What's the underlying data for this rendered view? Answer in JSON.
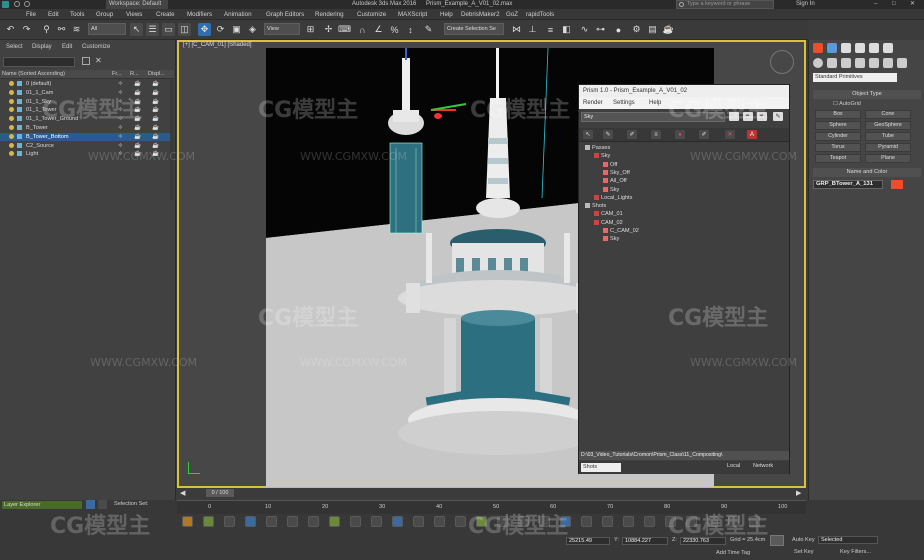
{
  "title_bar": {
    "workspace": "Workspace: Default",
    "app_title": "Autodesk 3ds Max 2016",
    "file": "Prism_Example_A_V01_02.max",
    "search_placeholder": "Type a keyword or phrase",
    "sign_in": "Sign In"
  },
  "menu": [
    "File",
    "Edit",
    "Tools",
    "Group",
    "Views",
    "Create",
    "Modifiers",
    "Animation",
    "Graph Editors",
    "Rendering",
    "Customize",
    "MAXScript",
    "Help",
    "DebrisMaker2",
    "GoZ",
    "rapidTools"
  ],
  "toolbar": {
    "filter_value": "All",
    "refcoord_value": "View",
    "selection_set_placeholder": "Create Selection Se"
  },
  "explorer": {
    "tabs": [
      "Select",
      "Display",
      "Edit",
      "Customize"
    ],
    "columns": [
      "Name (Sorted Ascending)",
      "Fr...",
      "R...",
      "Displ..."
    ],
    "rows": [
      {
        "label": "0 (default)",
        "selected": false
      },
      {
        "label": "01_1_Cam",
        "selected": false
      },
      {
        "label": "01_1_Sky",
        "selected": false
      },
      {
        "label": "01_1_Tower",
        "selected": false
      },
      {
        "label": "01_1_Tower_Ground",
        "selected": false
      },
      {
        "label": "B_Tower",
        "selected": false
      },
      {
        "label": "B_Tower_Bottom",
        "selected": true
      },
      {
        "label": "C2_Source",
        "selected": false
      },
      {
        "label": "Light",
        "selected": false
      }
    ],
    "layer_explorer": "Layer Explorer",
    "selection_set_label": "Selection Set:"
  },
  "viewport": {
    "label": "[+] [C_CAM_01] [Shaded]"
  },
  "prism": {
    "title": "Prism 1.0 - Prism_Example_A_V01_02",
    "menu": [
      "Render",
      "Settings",
      "Help"
    ],
    "filter": "Sky",
    "tree": [
      {
        "label": "Passes",
        "level": 0
      },
      {
        "label": "Sky",
        "level": 1
      },
      {
        "label": "Off",
        "level": 2
      },
      {
        "label": "Sky_Off",
        "level": 2
      },
      {
        "label": "All_Off",
        "level": 2
      },
      {
        "label": "Sky",
        "level": 2
      },
      {
        "label": "Local_Lights",
        "level": 1
      },
      {
        "label": "Shots",
        "level": 0
      },
      {
        "label": "CAM_01",
        "level": 1
      },
      {
        "label": "CAM_02",
        "level": 1
      },
      {
        "label": "C_CAM_02",
        "level": 2
      },
      {
        "label": "Sky",
        "level": 2
      }
    ],
    "path": "D:\\03_Video_Tutorials\\Cromon\\Prism_Class\\11_Compositing\\",
    "shots_value": "Shots",
    "local_btn": "Local",
    "network_btn": "Network"
  },
  "command_panel": {
    "category": "Standard Primitives",
    "object_type": "Object Type",
    "autogrid": "AutoGrid",
    "buttons": [
      "Box",
      "Cone",
      "Sphere",
      "GeoSphere",
      "Cylinder",
      "Tube",
      "Torus",
      "Pyramid",
      "Teapot",
      "Plane"
    ],
    "name_color": "Name and Color",
    "object_name": "GRP_BTower_A_131",
    "accent_color": "#e8502a"
  },
  "timeline": {
    "frame": "0 / 100",
    "ticks": [
      "0",
      "10",
      "20",
      "30",
      "40",
      "50",
      "60",
      "70",
      "80",
      "90",
      "100"
    ]
  },
  "status": {
    "x_value": "25215.49",
    "y_value": "10884.227",
    "z_value": "22330.763",
    "grid": "Grid = 25.4cm",
    "add_time_tag": "Add Time Tag",
    "auto_key": "Auto Key",
    "auto_key_value": "Selected",
    "set_key": "Set Key",
    "key_filters": "Key Filters..."
  },
  "watermark": {
    "brand": "CG模型主",
    "url": "WWW.CGMXW.COM"
  }
}
